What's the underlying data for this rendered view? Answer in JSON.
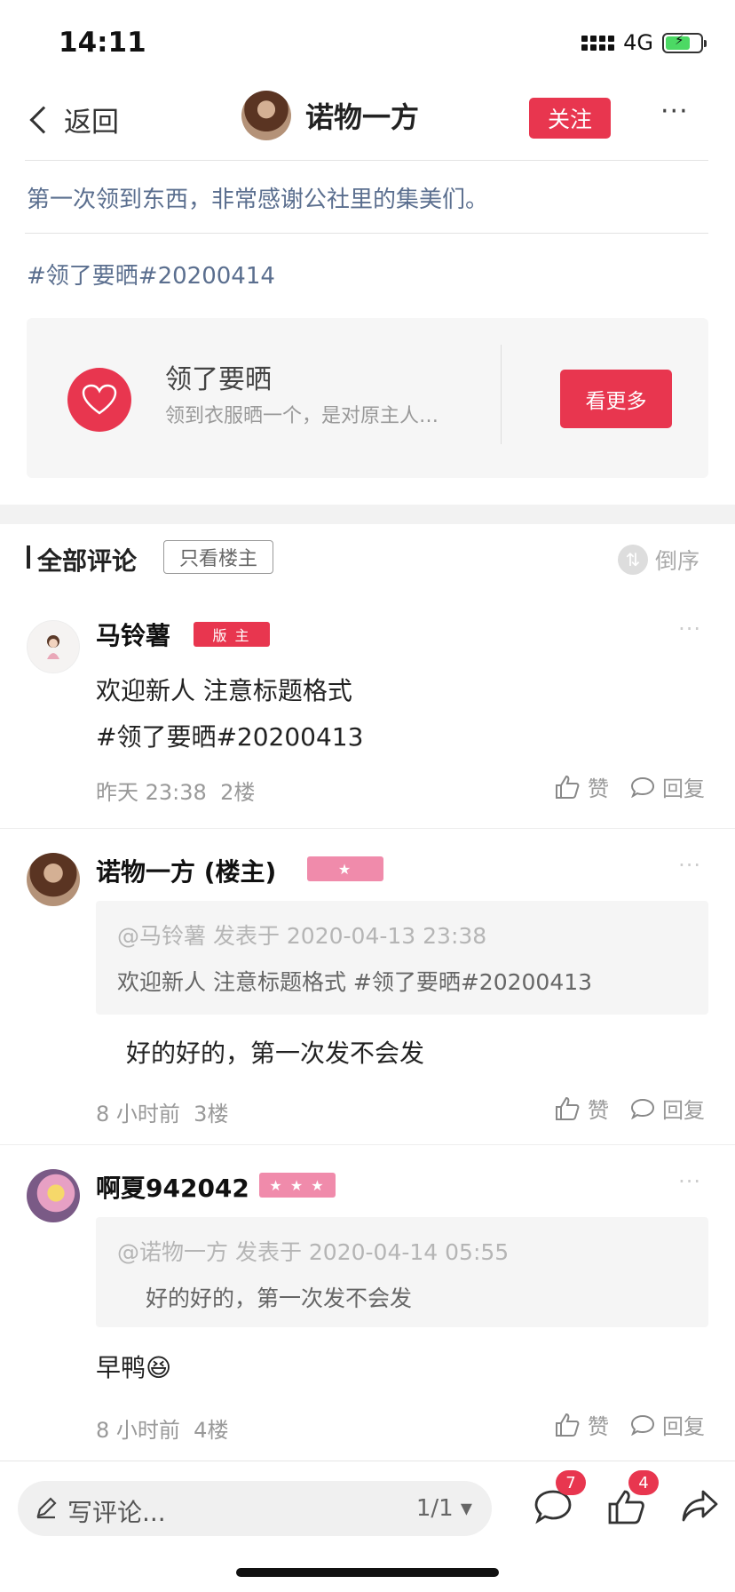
{
  "status_bar": {
    "time": "14:11",
    "network": "4G"
  },
  "nav": {
    "back_label": "返回",
    "author_name": "诺物一方",
    "follow_label": "关注",
    "more_label": "···"
  },
  "post": {
    "text": "第一次领到东西，非常感谢公社里的集美们。",
    "tag": "#领了要晒#20200414"
  },
  "topic_card": {
    "title": "领了要晒",
    "description": "领到衣服晒一个，是对原主人…",
    "button_label": "看更多"
  },
  "comments_header": {
    "title": "全部评论",
    "owner_only_label": "只看楼主",
    "sort_label": "倒序"
  },
  "comments": [
    {
      "name": "马铃薯",
      "badge": "版 主",
      "lines": [
        "欢迎新人 注意标题格式",
        "#领了要晒#20200413"
      ],
      "time": "昨天 23:38",
      "floor": "2楼",
      "like_label": "赞",
      "reply_label": "回复"
    },
    {
      "name": "诺物一方 (楼主)",
      "badge": "★",
      "quote_meta": "@马铃薯 发表于 2020-04-13 23:38",
      "quote_text": "欢迎新人 注意标题格式 #领了要晒#20200413",
      "text": "好的好的，第一次发不会发",
      "time": "8 小时前",
      "floor": "3楼",
      "like_label": "赞",
      "reply_label": "回复"
    },
    {
      "name": "啊夏942042",
      "badge": "★ ★ ★",
      "quote_meta": "@诺物一方 发表于 2020-04-14 05:55",
      "quote_text": "好的好的，第一次发不会发",
      "text": "早鸭😆",
      "time": "8 小时前",
      "floor": "4楼",
      "like_label": "赞",
      "reply_label": "回复"
    }
  ],
  "bottom_bar": {
    "write_placeholder": "写评论...",
    "page_indicator": "1/1 ▾",
    "comment_count": "7",
    "like_count": "4"
  },
  "colors": {
    "accent": "#e8364f",
    "link": "#5b6f8f",
    "badge_pink": "#f08bab"
  }
}
